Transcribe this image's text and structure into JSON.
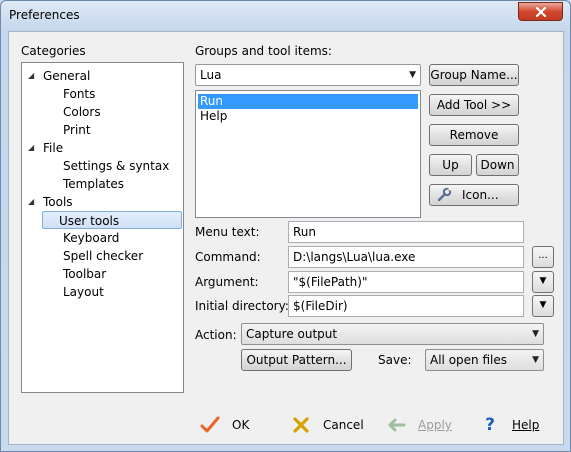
{
  "window": {
    "title": "Preferences"
  },
  "categories": {
    "label": "Categories",
    "items": [
      {
        "label": "General",
        "level": 0,
        "expanded": true
      },
      {
        "label": "Fonts",
        "level": 1
      },
      {
        "label": "Colors",
        "level": 1
      },
      {
        "label": "Print",
        "level": 1
      },
      {
        "label": "File",
        "level": 0,
        "expanded": true
      },
      {
        "label": "Settings & syntax",
        "level": 1
      },
      {
        "label": "Templates",
        "level": 1
      },
      {
        "label": "Tools",
        "level": 0,
        "expanded": true
      },
      {
        "label": "User tools",
        "level": 1,
        "selected": true
      },
      {
        "label": "Keyboard",
        "level": 1
      },
      {
        "label": "Spell checker",
        "level": 1
      },
      {
        "label": "Toolbar",
        "level": 1
      },
      {
        "label": "Layout",
        "level": 1
      }
    ]
  },
  "groups": {
    "label": "Groups and tool items:",
    "selected_group": "Lua",
    "items": [
      "Run",
      "Help"
    ],
    "selected_item": "Run"
  },
  "buttons": {
    "group_name": "Group Name...",
    "add_tool": "Add Tool >>",
    "remove": "Remove",
    "up": "Up",
    "down": "Down",
    "icon": "Icon..."
  },
  "fields": {
    "menu_text_label": "Menu text:",
    "menu_text_value": "Run",
    "command_label": "Command:",
    "command_value": "D:\\langs\\Lua\\lua.exe",
    "command_browse": "...",
    "argument_label": "Argument:",
    "argument_value": "\"$(FilePath)\"",
    "initial_dir_label": "Initial directory:",
    "initial_dir_value": "$(FileDir)"
  },
  "action": {
    "label": "Action:",
    "value": "Capture output",
    "output_pattern": "Output Pattern...",
    "save_label": "Save:",
    "save_value": "All open files"
  },
  "footer": {
    "ok": "OK",
    "cancel": "Cancel",
    "apply": "Apply",
    "help": "Help"
  },
  "colors": {
    "selection": "#3399ff",
    "ok_check": "#e8652a",
    "cancel_x": "#d8a000",
    "help_q": "#1f5fb8"
  }
}
